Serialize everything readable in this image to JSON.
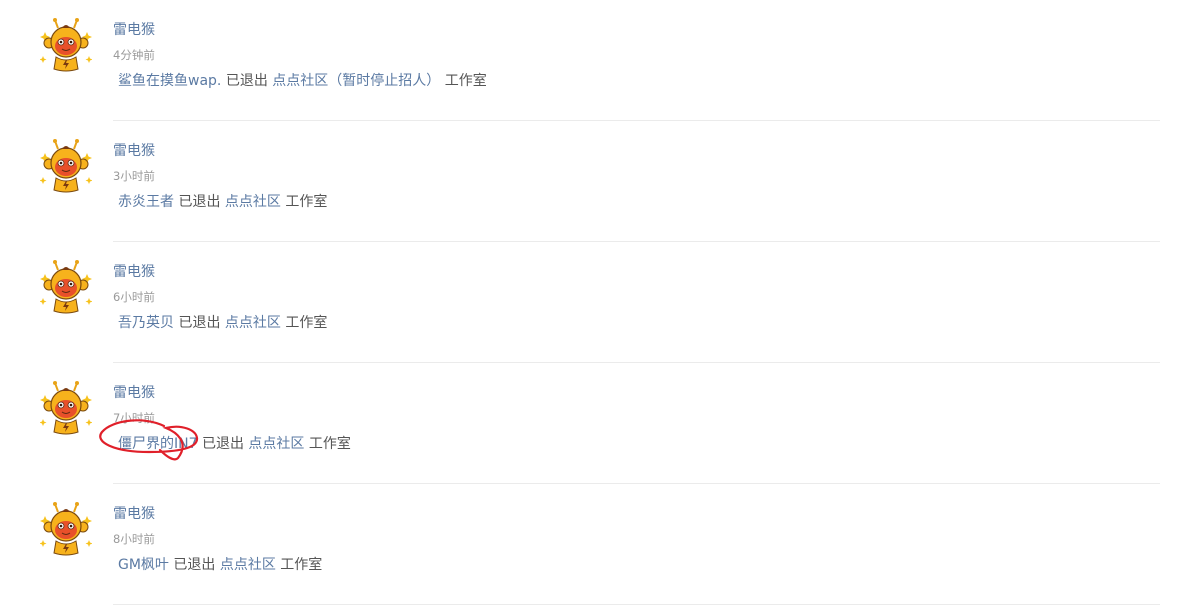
{
  "feed": {
    "items": [
      {
        "author": "雷电猴",
        "time": "4分钟前",
        "user": "鲨鱼在摸鱼wap.",
        "action": "已退出",
        "group": "点点社区（暂时停止招人）",
        "suffix": "工作室"
      },
      {
        "author": "雷电猴",
        "time": "3小时前",
        "user": "赤炎王者",
        "action": "已退出",
        "group": "点点社区",
        "suffix": "工作室"
      },
      {
        "author": "雷电猴",
        "time": "6小时前",
        "user": "吾乃英贝",
        "action": "已退出",
        "group": "点点社区",
        "suffix": "工作室"
      },
      {
        "author": "雷电猴",
        "time": "7小时前",
        "user": "僵尸界的IN7",
        "action": "已退出",
        "group": "点点社区",
        "suffix": "工作室"
      },
      {
        "author": "雷电猴",
        "time": "8小时前",
        "user": "GM枫叶",
        "action": "已退出",
        "group": "点点社区",
        "suffix": "工作室"
      }
    ],
    "avatar_icon": "monkey-mascot-icon",
    "colors": {
      "link": "#5b7aa3",
      "text": "#555555",
      "meta": "#9a9a9a",
      "annotation": "#e0202a"
    }
  }
}
